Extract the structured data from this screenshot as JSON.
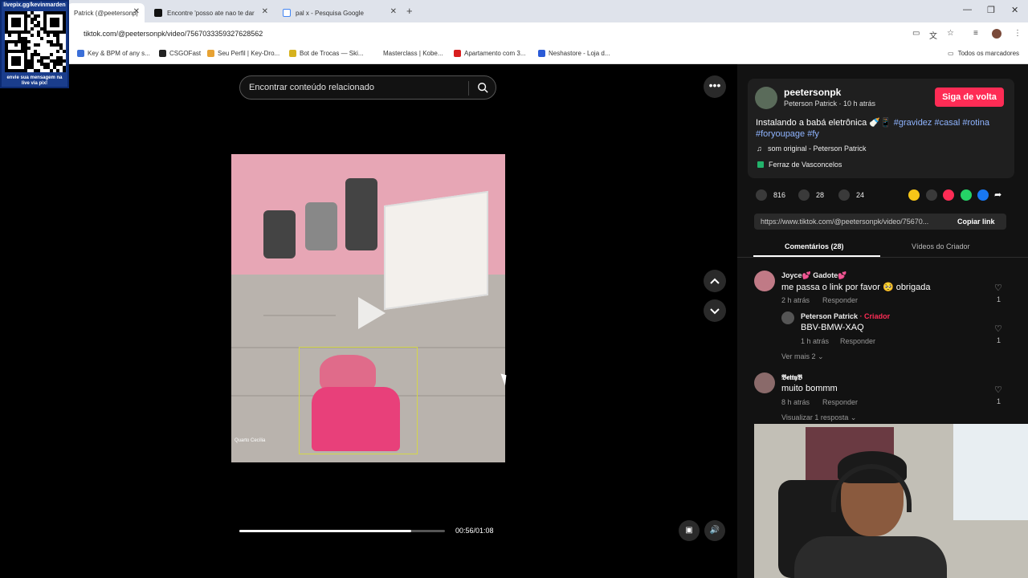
{
  "browser": {
    "tabs": [
      {
        "label": "Patrick (@peetersonp|",
        "active": true
      },
      {
        "label": "Encontre 'posso ate nao te dar",
        "active": false
      },
      {
        "label": "pal x - Pesquisa Google",
        "active": false
      }
    ],
    "url": "tiktok.com/@peetersonpk/video/7567033359327628562",
    "bookmarks": [
      "Key & BPM of any s...",
      "CSGOFast",
      "Seu Perfil | Key-Dro...",
      "Bot de Trocas — Ski...",
      "Masterclass | Kobe...",
      "Apartamento com 3...",
      "Neshastore - Loja d..."
    ],
    "all_bookmarks": "Todos os marcadores"
  },
  "overlay": {
    "qr_top": "livepix.gg/kevinmarden",
    "qr_bottom_1": "envie sua mensagem na",
    "qr_bottom_2": "live via pix!"
  },
  "player": {
    "search_placeholder": "Encontrar conteúdo relacionado",
    "time": "00:56/01:08",
    "progress_fraction": 0.836,
    "cam_label": "Quarto Cecília"
  },
  "info": {
    "username": "peetersonpk",
    "subtitle": "Peterson Patrick · 10 h atrás",
    "follow_label": "Siga de volta",
    "caption_text": "Instalando a babá eletrônica",
    "hashtags": "#gravidez #casal #rotina #foryoupage #fy",
    "music": "som original - Peterson Patrick",
    "location": "Ferraz de Vasconcelos",
    "likes": "816",
    "comments": "28",
    "saves": "24",
    "link": "https://www.tiktok.com/@peetersonpk/video/75670...",
    "copy_link": "Copiar link",
    "tab_comments": "Comentários (28)",
    "tab_videos": "Vídeos do Criador"
  },
  "comments": [
    {
      "name": "Joyce💕 Gadote💕",
      "text": "me passa o link por favor 🥺 obrigada",
      "time": "2 h atrás",
      "reply": "Responder",
      "likes": "1"
    },
    {
      "name": "Peterson Patrick",
      "creator": "· Criador",
      "text": "BBV-BMW-XAQ",
      "time": "1 h atrás",
      "reply": "Responder",
      "likes": "1"
    },
    {
      "name": "𝕭𝖊𝖙𝖙𝖞𝕭",
      "text": "muito bommm",
      "time": "8 h atrás",
      "reply": "Responder",
      "likes": "1"
    }
  ],
  "more_replies": "Ver mais 2",
  "view_reply": "Visualizar 1 resposta"
}
